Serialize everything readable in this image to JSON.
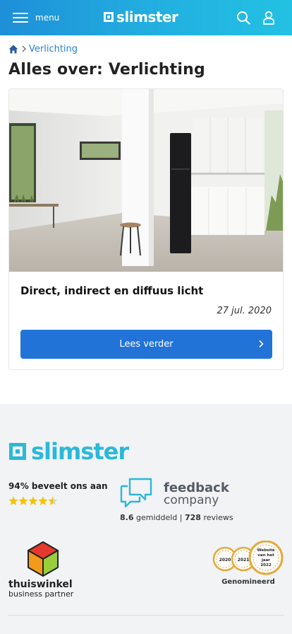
{
  "header": {
    "menu_label": "menu",
    "brand": "slimster",
    "icons": [
      "hamburger-icon",
      "search-icon",
      "user-icon"
    ],
    "colors": {
      "gradient_start": "#1e8fd8",
      "gradient_end": "#23c1e3"
    }
  },
  "breadcrumb": {
    "home_icon": "home-icon",
    "separator_icon": "chevron-right-icon",
    "current": "Verlichting"
  },
  "page": {
    "title": "Alles over: Verlichting"
  },
  "article": {
    "title": "Direct, indirect en diffuus licht",
    "date": "27 jul. 2020",
    "button_label": "Lees verder",
    "button_color": "#2273d8"
  },
  "footer": {
    "brand": "slimster",
    "brand_color": "#2bb8d9",
    "recommend_text": "94% beveelt ons aan",
    "rating_stars": 4.5,
    "feedback_company": {
      "word1": "feedback",
      "word2": "company",
      "score": "8.6",
      "score_label": "gemiddeld |",
      "review_count": "728",
      "reviews_label": "reviews"
    },
    "thuiswinkel": {
      "name": "thuiswinkel",
      "subtitle": "business partner"
    },
    "awards": {
      "years": [
        "2020",
        "2021"
      ],
      "main_lines": [
        "Website",
        "van het",
        "jaar",
        "2022"
      ],
      "caption": "Genomineerd"
    }
  }
}
